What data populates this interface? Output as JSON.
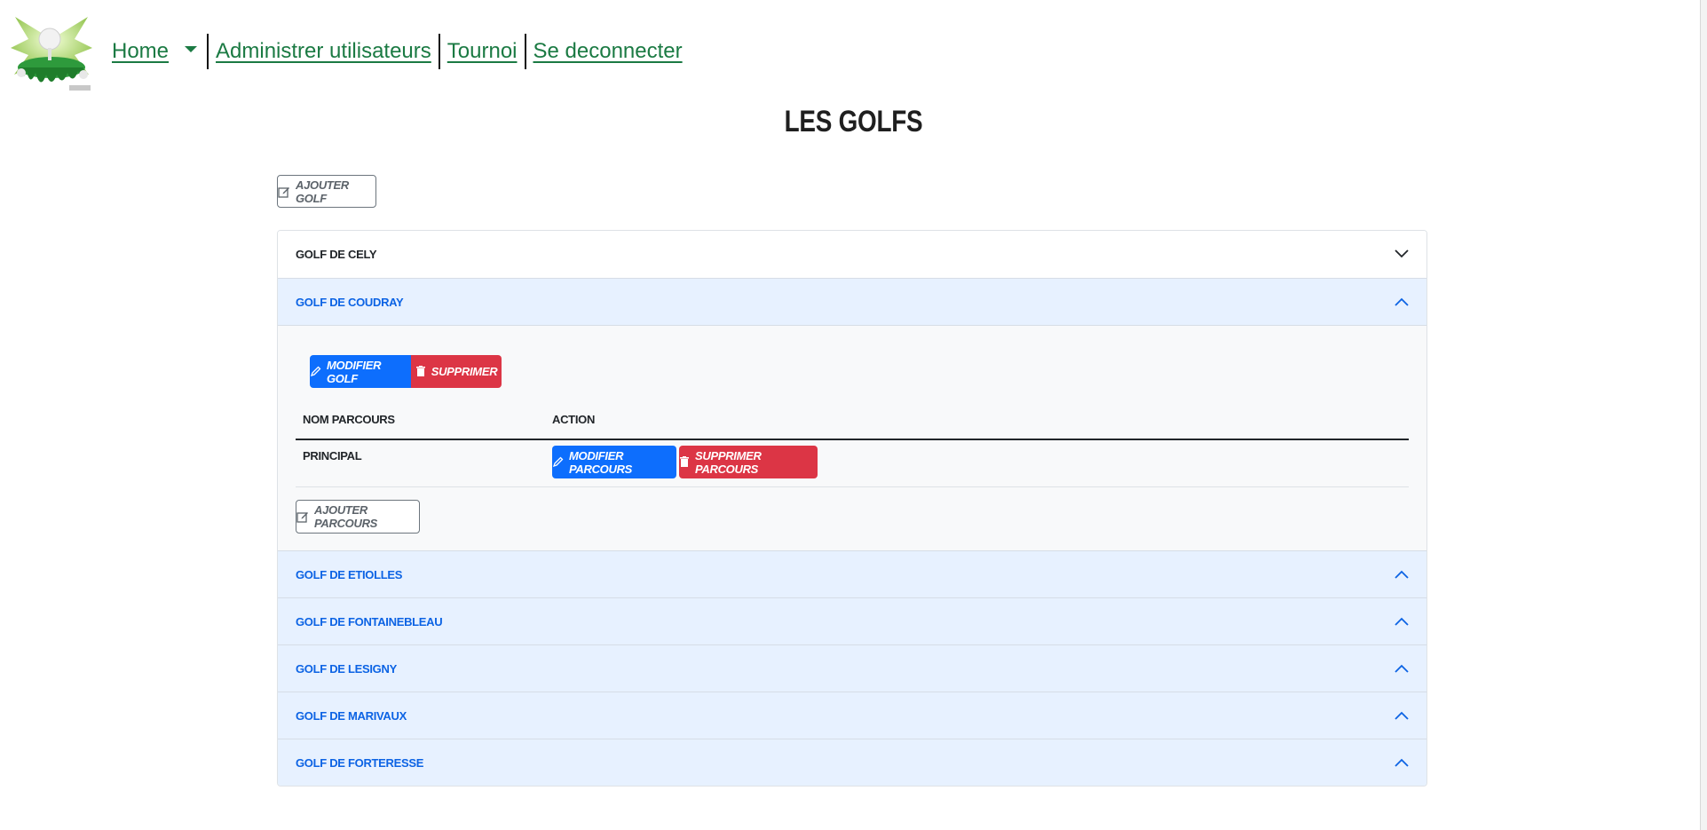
{
  "nav": {
    "home": "Home",
    "admin_users": "Administrer utilisateurs",
    "tournoi": "Tournoi",
    "logout": "Se deconnecter"
  },
  "page": {
    "title": "LES GOLFS"
  },
  "add_golf_label": "AJOUTER GOLF",
  "golfs": [
    {
      "name": "GOLF DE CELY",
      "state": "collapsed"
    },
    {
      "name": "GOLF DE COUDRAY",
      "state": "expanded"
    },
    {
      "name": "GOLF DE ETIOLLES",
      "state": "expanded"
    },
    {
      "name": "GOLF DE FONTAINEBLEAU",
      "state": "expanded"
    },
    {
      "name": "GOLF DE LESIGNY",
      "state": "expanded"
    },
    {
      "name": "GOLF DE MARIVAUX",
      "state": "expanded"
    },
    {
      "name": "GOLF DE FORTERESSE",
      "state": "expanded"
    }
  ],
  "panel": {
    "modify_golf": "MODIFIER GOLF",
    "delete": "SUPPRIMER",
    "table": {
      "headers": [
        "NOM PARCOURS",
        "ACTION"
      ],
      "rows": [
        {
          "name": "PRINCIPAL",
          "modify": "MODIFIER PARCOURS",
          "delete": "SUPPRIMER PARCOURS"
        }
      ]
    },
    "add_course": "AJOUTER PARCOURS"
  },
  "colors": {
    "nav_link": "#1b7a43",
    "primary": "#0d6efd",
    "danger": "#dc3545",
    "accordion_open_bg": "#e7f1ff",
    "accordion_open_text": "#0c63e4"
  }
}
